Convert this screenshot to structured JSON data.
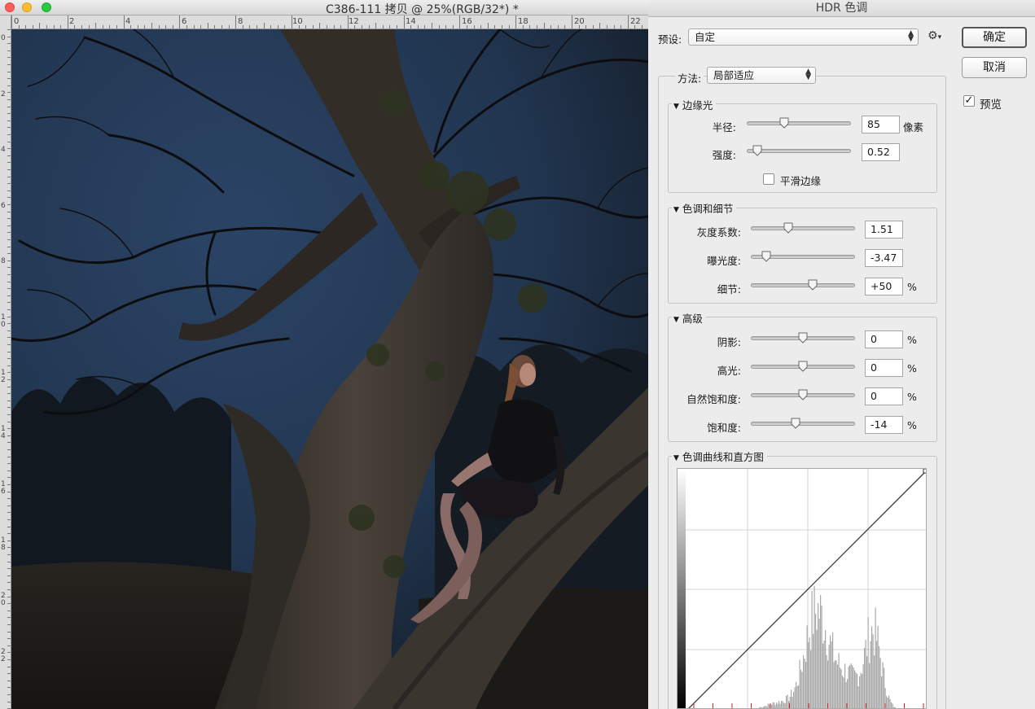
{
  "document": {
    "title": "C386-111 拷贝 @ 25%(RGB/32*) *",
    "ruler_top_labels": [
      "0",
      "2",
      "4",
      "6",
      "8",
      "10",
      "12",
      "14",
      "16",
      "18",
      "20",
      "22"
    ],
    "ruler_left_labels": [
      "0",
      "2",
      "4",
      "6",
      "8",
      "1\n0",
      "1\n2",
      "1\n4",
      "1\n6",
      "1\n8",
      "2\n0",
      "2\n2"
    ]
  },
  "dialog": {
    "title": "HDR 色调",
    "preset_label": "预设:",
    "preset_value": "自定",
    "method_label": "方法:",
    "method_value": "局部适应",
    "ok_button": "确定",
    "cancel_button": "取消",
    "preview_label": "预览",
    "preview_checked": true,
    "edge_glow": {
      "title": "边缘光",
      "radius": {
        "label": "半径:",
        "value": "85",
        "unit": "像素",
        "level": 0.36
      },
      "strength": {
        "label": "强度:",
        "value": "0.52",
        "unit": "",
        "level": 0.1
      },
      "smooth_edges": {
        "label": "平滑边缘",
        "checked": false
      }
    },
    "tone_detail": {
      "title": "色调和细节",
      "gamma": {
        "label": "灰度系数:",
        "value": "1.51",
        "unit": "",
        "level": 0.36
      },
      "exposure": {
        "label": "曝光度:",
        "value": "-3.47",
        "unit": "",
        "level": 0.15
      },
      "detail": {
        "label": "细节:",
        "value": "+50",
        "unit": "%",
        "level": 0.59
      }
    },
    "advanced": {
      "title": "高级",
      "shadow": {
        "label": "阴影:",
        "value": "0",
        "unit": "%",
        "level": 0.5
      },
      "highlight": {
        "label": "高光:",
        "value": "0",
        "unit": "%",
        "level": 0.5
      },
      "vibrance": {
        "label": "自然饱和度:",
        "value": "0",
        "unit": "%",
        "level": 0.5
      },
      "saturation": {
        "label": "饱和度:",
        "value": "-14",
        "unit": "%",
        "level": 0.43
      }
    },
    "curve": {
      "title": "色调曲线和直方图"
    }
  }
}
